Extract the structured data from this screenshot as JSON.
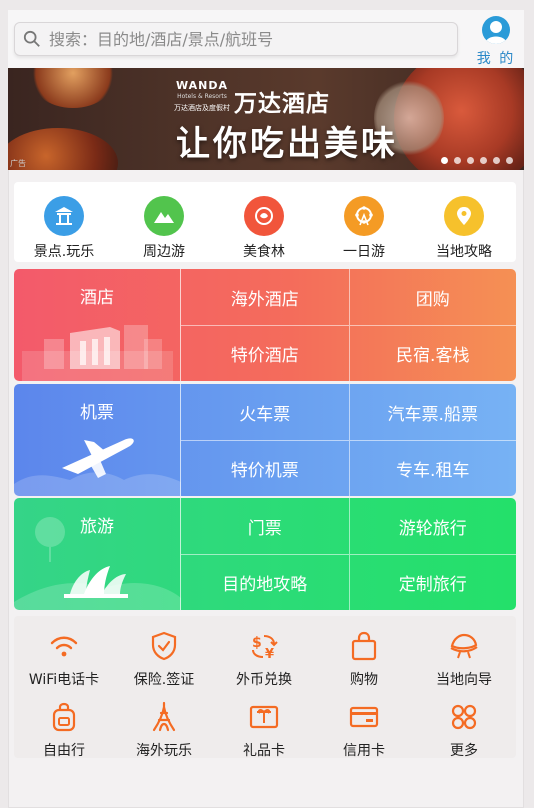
{
  "search": {
    "placeholder": "搜索：目的地/酒店/景点/航班号"
  },
  "me": {
    "label": "我 的"
  },
  "banner": {
    "brand_main": "WANDA",
    "brand_sub": "Hotels & Resorts",
    "brand_cn": "万达酒店及度假村",
    "title": "万达酒店",
    "slogan": "让你吃出美味",
    "ad_tag": "广告",
    "dot_count": 6,
    "active_dot": 0
  },
  "quick": [
    {
      "label": "景点.玩乐",
      "icon": "temple-icon",
      "color": "#3b9ee6"
    },
    {
      "label": "周边游",
      "icon": "mountain-icon",
      "color": "#52c44d"
    },
    {
      "label": "美食林",
      "icon": "food-icon",
      "color": "#f1553b"
    },
    {
      "label": "一日游",
      "icon": "ferris-wheel-icon",
      "color": "#f49b25"
    },
    {
      "label": "当地攻略",
      "icon": "location-pin-icon",
      "color": "#f6c12c"
    }
  ],
  "grids": {
    "hotel": {
      "title": "酒店",
      "cells": [
        "海外酒店",
        "团购",
        "特价酒店",
        "民宿.客栈"
      ]
    },
    "flight": {
      "title": "机票",
      "cells": [
        "火车票",
        "汽车票.船票",
        "特价机票",
        "专车.租车"
      ]
    },
    "tour": {
      "title": "旅游",
      "cells": [
        "门票",
        "游轮旅行",
        "目的地攻略",
        "定制旅行"
      ]
    }
  },
  "services": [
    {
      "label": "WiFi电话卡",
      "icon": "wifi-icon"
    },
    {
      "label": "保险.签证",
      "icon": "shield-icon"
    },
    {
      "label": "外币兑换",
      "icon": "currency-exchange-icon"
    },
    {
      "label": "购物",
      "icon": "shopping-bag-icon"
    },
    {
      "label": "当地向导",
      "icon": "guide-hat-icon"
    },
    {
      "label": "自由行",
      "icon": "backpack-icon"
    },
    {
      "label": "海外玩乐",
      "icon": "eiffel-tower-icon"
    },
    {
      "label": "礼品卡",
      "icon": "gift-card-icon"
    },
    {
      "label": "信用卡",
      "icon": "credit-card-icon"
    },
    {
      "label": "更多",
      "icon": "more-icon"
    }
  ],
  "colors": {
    "accent": "#f46b23",
    "link": "#2a88c8"
  }
}
